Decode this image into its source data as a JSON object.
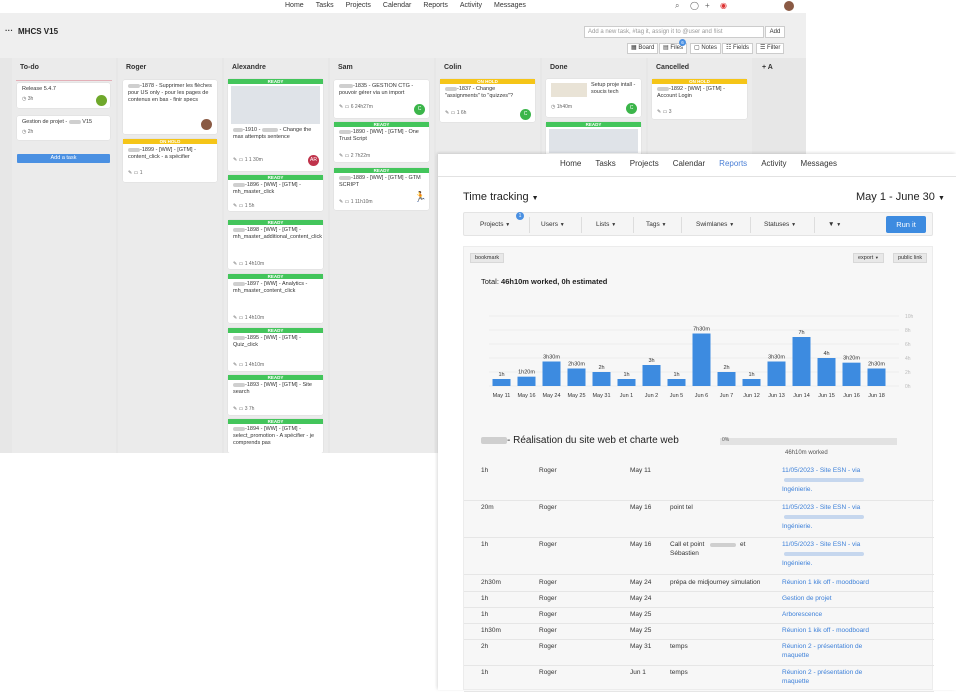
{
  "topnav": {
    "items": [
      "Home",
      "Tasks",
      "Projects",
      "Calendar",
      "Reports",
      "Activity",
      "Messages"
    ]
  },
  "board": {
    "title": "MHCS V15",
    "new_task_placeholder": "Add a new task, #tag it, assign it to @user and !list",
    "add_label": "Add",
    "views": [
      "Board",
      "Files",
      "Notes",
      "Fields",
      "Filter"
    ],
    "files_badge": "6",
    "add_list": "+ A",
    "add_task_label": "Add a task",
    "columns": [
      {
        "name": "To-do"
      },
      {
        "name": "Roger"
      },
      {
        "name": "Alexandre"
      },
      {
        "name": "Sam"
      },
      {
        "name": "Colin"
      },
      {
        "name": "Done"
      },
      {
        "name": "Cancelled"
      }
    ],
    "labels": {
      "ready": "READY",
      "hold": "ON HOLD"
    },
    "cards": {
      "todo1": {
        "title": "Release 5.4.7",
        "meta": "3h"
      },
      "todo2": {
        "title": "Gestion de projet - ",
        "title2": " V15",
        "meta": "2h"
      },
      "roger1": {
        "pre": "-1878 - Supprimer les flèches pour US only - pour les pages de contenus en bas - finir specs"
      },
      "roger2": {
        "pre": "-1899 - [WW] - [GTM] - content_click - a spécifier",
        "meta": "1"
      },
      "alex1": {
        "pre": "-1910 - ",
        "post": " - Change the max attempts sentence",
        "meta": "1  1  30m",
        "av": "AR"
      },
      "alex2": {
        "pre": "-1896 - [WW] - [GTM] - mh_master_click",
        "meta": "1  5h"
      },
      "alex3": {
        "pre": "-1898 - [WW] - [GTM] - mh_master_additional_content_click",
        "meta": "1  4h10m"
      },
      "alex4": {
        "pre": "-1897 - [WW] - Analytics - mh_master_content_click",
        "meta": "1  4h10m"
      },
      "alex5": {
        "pre": "-1895 - [WW] - [GTM] - Quiz_click",
        "meta": "1  4h10m"
      },
      "alex6": {
        "pre": "-1893 - [WW] - [GTM] - Site search",
        "meta": "3  7h"
      },
      "alex7": {
        "pre": "-1894 - [WW] - [GTM] - select_promotion - A spécifier - je comprends pas"
      },
      "sam1": {
        "pre": "-1835 - GESTION CTG - pouvoir gérer via un import",
        "meta": "6  24h27m",
        "av": "C"
      },
      "sam2": {
        "pre": "-1890 - [WW] - [GTM] - One Trust Script",
        "meta": "2  7h22m"
      },
      "sam3": {
        "pre": "-1889 - [WW] - [GTM] - GTM SCRIPT",
        "meta": "1  11h10m"
      },
      "colin1": {
        "pre": "-1837 - Change \"assignments\" to \"quizzes\"?",
        "meta": "1  6h",
        "av": "C"
      },
      "done1": {
        "pre": "Setup proje intall - soucis tech",
        "meta": "1h40m",
        "av": "C"
      },
      "canc1": {
        "pre": "-1892 - [WW] - [GTM] - Account Login",
        "meta": "3"
      }
    }
  },
  "reports": {
    "nav": [
      "Home",
      "Tasks",
      "Projects",
      "Calendar",
      "Reports",
      "Activity",
      "Messages"
    ],
    "active": "Reports",
    "title": "Time tracking",
    "range": "May 1 - June 30",
    "filters": [
      "Projects",
      "Users",
      "Lists",
      "Tags",
      "Swimlanes",
      "Statuses"
    ],
    "projects_badge": "1",
    "run_label": "Run it",
    "bookmark": "bookmark",
    "export": "export",
    "public_link": "public link",
    "total_label": "Total:",
    "total_value": "46h10m worked, 0h estimated",
    "project_title": "- Réalisation du site web et charte web",
    "progress": "0%",
    "worked": "46h10m worked",
    "rows": [
      {
        "dur": "1h",
        "user": "Roger",
        "date": "May 11",
        "note": "",
        "task": "11/05/2023 - Site ESN - via",
        "task2": "",
        "task3": "Ingénierie."
      },
      {
        "dur": "20m",
        "user": "Roger",
        "date": "May 16",
        "note": "point tel",
        "task": "11/05/2023 - Site ESN - via",
        "task2": "",
        "task3": "Ingénierie."
      },
      {
        "dur": "1h",
        "user": "Roger",
        "date": "May 16",
        "note": "Call et point",
        "note2": "et",
        "note3": "Sébastien",
        "task": "11/05/2023 - Site ESN - via",
        "task2": "",
        "task3": "Ingénierie."
      },
      {
        "dur": "2h30m",
        "user": "Roger",
        "date": "May 24",
        "note": "prépa de midjourney simulation",
        "task": "Réunion 1 kik off - moodboard"
      },
      {
        "dur": "1h",
        "user": "Roger",
        "date": "May 24",
        "note": "",
        "task": "Gestion de projet"
      },
      {
        "dur": "1h",
        "user": "Roger",
        "date": "May 25",
        "note": "",
        "task": "Arborescence"
      },
      {
        "dur": "1h30m",
        "user": "Roger",
        "date": "May 25",
        "note": "",
        "task": "Réunion 1 kik off - moodboard"
      },
      {
        "dur": "2h",
        "user": "Roger",
        "date": "May 31",
        "note": "temps",
        "task": "Réunion 2 - présentation de",
        "task3": "maquette"
      },
      {
        "dur": "1h",
        "user": "Roger",
        "date": "Jun 1",
        "note": "temps",
        "task": "Réunion 2 - présentation de",
        "task3": "maquette"
      }
    ]
  },
  "chart_data": {
    "type": "bar",
    "categories": [
      "May 11",
      "May 16",
      "May 24",
      "May 25",
      "May 31",
      "Jun 1",
      "Jun 2",
      "Jun 5",
      "Jun 6",
      "Jun 7",
      "Jun 12",
      "Jun 13",
      "Jun 14",
      "Jun 15",
      "Jun 16",
      "Jun 18"
    ],
    "values": [
      1,
      1.3333,
      3.5,
      2.5,
      2,
      1,
      3,
      1,
      7.5,
      2,
      1,
      3.5,
      7,
      4,
      3.3333,
      2.5
    ],
    "data_labels": [
      "1h",
      "1h20m",
      "3h30m",
      "2h30m",
      "2h",
      "1h",
      "3h",
      "1h",
      "7h30m",
      "2h",
      "1h",
      "3h30m",
      "7h",
      "4h",
      "3h20m",
      "2h30m"
    ],
    "y_ticks": [
      "0h",
      "2h",
      "4h",
      "6h",
      "8h",
      "10h"
    ],
    "ylim": [
      0,
      10
    ],
    "color": "#3d8be0",
    "grid": true
  }
}
